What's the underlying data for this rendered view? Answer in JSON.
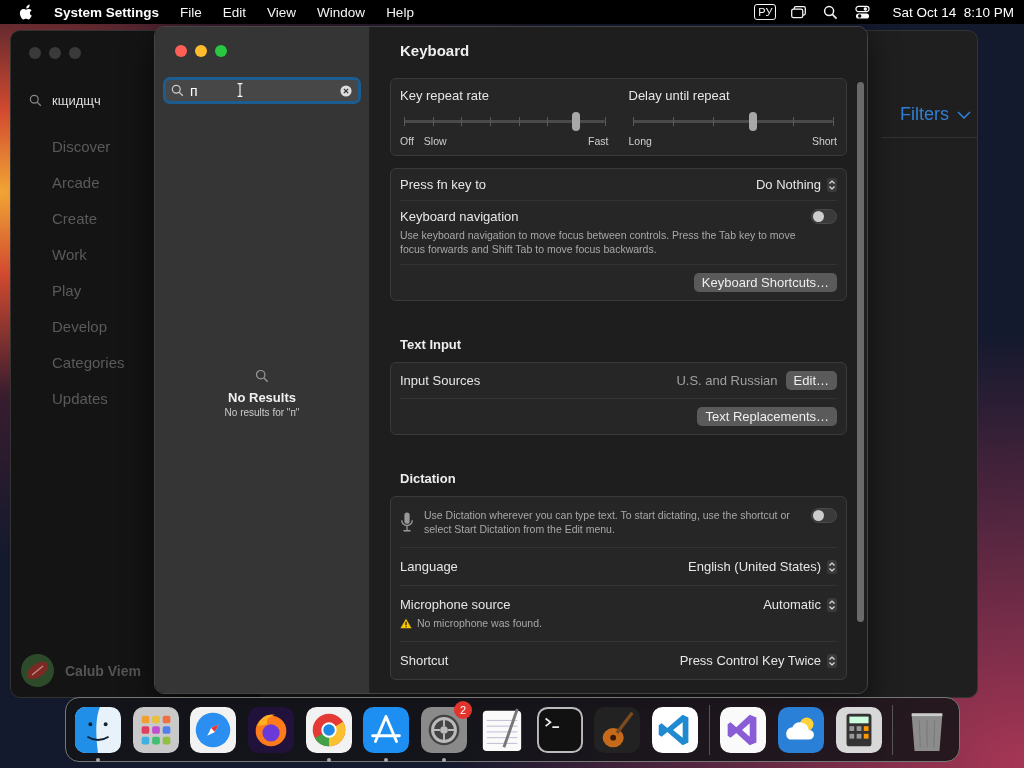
{
  "menu_bar": {
    "app_name": "System Settings",
    "menus": [
      "File",
      "Edit",
      "View",
      "Window",
      "Help"
    ],
    "input_source": "РУ",
    "clock": "Sat Oct 14  8:10 PM"
  },
  "background_window": {
    "search": {
      "value": "кщидщч"
    },
    "sidebar": [
      {
        "label": "Discover",
        "selected": false
      },
      {
        "label": "Arcade",
        "selected": false
      },
      {
        "label": "Create",
        "selected": false
      },
      {
        "label": "Work",
        "selected": false
      },
      {
        "label": "Play",
        "selected": false
      },
      {
        "label": "Develop",
        "selected": false
      },
      {
        "label": "Categories",
        "selected": false
      },
      {
        "label": "Updates",
        "selected": false
      }
    ],
    "account": {
      "name": "Calub Viem"
    },
    "filters": "Filters"
  },
  "settings_window": {
    "search": {
      "value": "п"
    },
    "no_results": {
      "title": "No Results",
      "message": "No results for \"п\""
    },
    "title": "Keyboard",
    "sliders": [
      {
        "label": "Key repeat rate",
        "level": 0.857,
        "scale": [
          "Off",
          "Slow",
          "Fast"
        ]
      },
      {
        "label": "Delay until repeat",
        "level": 0.6,
        "scale": [
          "Long",
          "Short"
        ]
      }
    ],
    "fn_key": {
      "label": "Press fn key to",
      "value": "Do Nothing"
    },
    "navigation": {
      "label": "Keyboard navigation",
      "description": "Use keyboard navigation to move focus between controls. Press the Tab key to move focus forwards and Shift Tab to move focus backwards.",
      "on": false
    },
    "shortcuts_button": "Keyboard Shortcuts…",
    "text_input": {
      "heading": "Text Input",
      "label": "Input Sources",
      "value": "U.S. and Russian",
      "edit_button": "Edit…",
      "replacements_button": "Text Replacements…"
    },
    "dictation": {
      "heading": "Dictation",
      "description": "Use Dictation wherever you can type text. To start dictating, use the shortcut or select Start Dictation from the Edit menu.",
      "on": false,
      "rows": [
        {
          "label": "Language",
          "value": "English (United States)"
        },
        {
          "label": "Microphone source",
          "value": "Automatic",
          "warning": "No microphone was found."
        },
        {
          "label": "Shortcut",
          "value": "Press Control Key Twice"
        }
      ]
    }
  },
  "dock": {
    "items": [
      {
        "kind": "finder",
        "running": true
      },
      {
        "kind": "launchpad",
        "running": false
      },
      {
        "kind": "safari",
        "running": false
      },
      {
        "kind": "firefox",
        "running": false
      },
      {
        "kind": "chrome",
        "running": true
      },
      {
        "kind": "appstore",
        "running": true
      },
      {
        "kind": "settings",
        "running": true,
        "badge": "2"
      },
      {
        "kind": "textedit",
        "running": false
      },
      {
        "kind": "terminal",
        "running": false
      },
      {
        "kind": "garageband",
        "running": false
      },
      {
        "kind": "vscode",
        "running": false
      },
      {
        "kind": "separator"
      },
      {
        "kind": "visualstudio",
        "running": false
      },
      {
        "kind": "weather",
        "running": false
      },
      {
        "kind": "calculator",
        "running": false
      },
      {
        "kind": "separator"
      },
      {
        "kind": "trash",
        "running": false
      }
    ]
  }
}
